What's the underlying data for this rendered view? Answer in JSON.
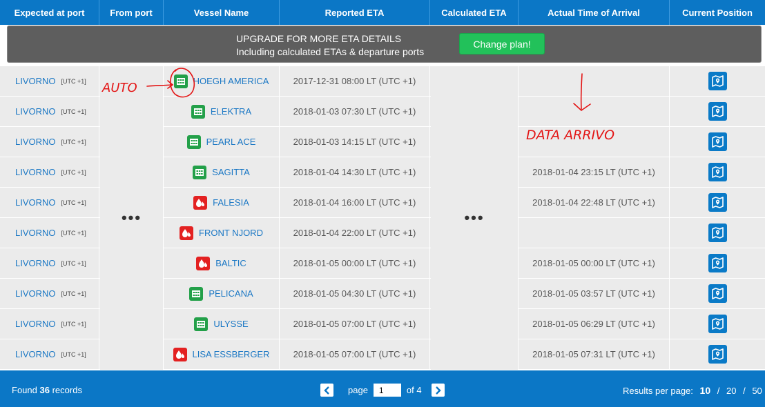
{
  "header": {
    "columns": [
      "Expected at port",
      "From port",
      "Vessel Name",
      "Reported ETA",
      "Calculated ETA",
      "Actual Time of Arrival",
      "Current Position"
    ]
  },
  "upgrade": {
    "line1": "UPGRADE FOR MORE ETA DETAILS",
    "line2": "Including calculated ETAs & departure ports",
    "button": "Change plan!"
  },
  "rows": [
    {
      "port": "LIVORNO",
      "tz": "[UTC +1]",
      "vessel": "HOEGH AMERICA",
      "icon": "grid-cargo-icon",
      "reported": "2017-12-31 08:00 LT (UTC +1)",
      "actual": ""
    },
    {
      "port": "LIVORNO",
      "tz": "[UTC +1]",
      "vessel": "ELEKTRA",
      "icon": "grid-cargo-icon",
      "reported": "2018-01-03 07:30 LT (UTC +1)",
      "actual": ""
    },
    {
      "port": "LIVORNO",
      "tz": "[UTC +1]",
      "vessel": "PEARL ACE",
      "icon": "grid-cargo-icon",
      "reported": "2018-01-03 14:15 LT (UTC +1)",
      "actual": ""
    },
    {
      "port": "LIVORNO",
      "tz": "[UTC +1]",
      "vessel": "SAGITTA",
      "icon": "grid-cargo-icon",
      "reported": "2018-01-04 14:30 LT (UTC +1)",
      "actual": "2018-01-04 23:15 LT (UTC +1)"
    },
    {
      "port": "LIVORNO",
      "tz": "[UTC +1]",
      "vessel": "FALESIA",
      "icon": "tanker-drop-icon",
      "reported": "2018-01-04 16:00 LT (UTC +1)",
      "actual": "2018-01-04 22:48 LT (UTC +1)"
    },
    {
      "port": "LIVORNO",
      "tz": "[UTC +1]",
      "vessel": "FRONT NJORD",
      "icon": "tanker-drop-icon",
      "reported": "2018-01-04 22:00 LT (UTC +1)",
      "actual": ""
    },
    {
      "port": "LIVORNO",
      "tz": "[UTC +1]",
      "vessel": "BALTIC",
      "icon": "tanker-drop-icon",
      "reported": "2018-01-05 00:00 LT (UTC +1)",
      "actual": "2018-01-05 00:00 LT (UTC +1)"
    },
    {
      "port": "LIVORNO",
      "tz": "[UTC +1]",
      "vessel": "PELICANA",
      "icon": "grid-cargo-icon",
      "reported": "2018-01-05 04:30 LT (UTC +1)",
      "actual": "2018-01-05 03:57 LT (UTC +1)"
    },
    {
      "port": "LIVORNO",
      "tz": "[UTC +1]",
      "vessel": "ULYSSE",
      "icon": "grid-cargo-icon",
      "reported": "2018-01-05 07:00 LT (UTC +1)",
      "actual": "2018-01-05 06:29 LT (UTC +1)"
    },
    {
      "port": "LIVORNO",
      "tz": "[UTC +1]",
      "vessel": "LISA ESSBERGER",
      "icon": "tanker-drop-icon",
      "reported": "2018-01-05 07:00 LT (UTC +1)",
      "actual": "2018-01-05 07:31 LT (UTC +1)"
    }
  ],
  "hidden_cells": {
    "from_port": "•••",
    "calculated_eta": "•••"
  },
  "footer": {
    "found_prefix": "Found",
    "found_count": "36",
    "found_suffix": "records",
    "page_label": "page",
    "page_value": "1",
    "of_label": "of 4",
    "rpp_label": "Results per page:",
    "rpp_options": [
      "10",
      "20",
      "50"
    ],
    "rpp_selected": "10"
  },
  "annotations": {
    "auto": "AUTO",
    "data_arrivo": "DATA ARRIVO"
  },
  "colors": {
    "header_blue": "#0b77c6",
    "link_blue": "#1a77c4",
    "cargo_green": "#23a049",
    "tanker_red": "#e32121",
    "cta_green": "#22c15a"
  }
}
